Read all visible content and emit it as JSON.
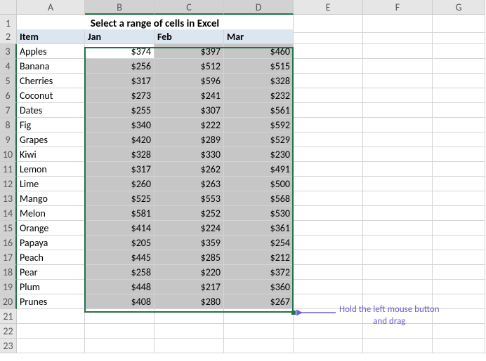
{
  "colLetters": [
    "A",
    "B",
    "C",
    "D",
    "E",
    "F",
    "G"
  ],
  "title": "Select a range of cells in Excel",
  "headers": [
    "Item",
    "Jan",
    "Feb",
    "Mar"
  ],
  "rows": [
    {
      "item": "Apples",
      "jan": "$374",
      "feb": "$397",
      "mar": "$460"
    },
    {
      "item": "Banana",
      "jan": "$256",
      "feb": "$512",
      "mar": "$515"
    },
    {
      "item": "Cherries",
      "jan": "$317",
      "feb": "$596",
      "mar": "$328"
    },
    {
      "item": "Coconut",
      "jan": "$273",
      "feb": "$241",
      "mar": "$232"
    },
    {
      "item": "Dates",
      "jan": "$255",
      "feb": "$307",
      "mar": "$561"
    },
    {
      "item": "Fig",
      "jan": "$340",
      "feb": "$222",
      "mar": "$592"
    },
    {
      "item": "Grapes",
      "jan": "$420",
      "feb": "$289",
      "mar": "$529"
    },
    {
      "item": "Kiwi",
      "jan": "$328",
      "feb": "$330",
      "mar": "$230"
    },
    {
      "item": "Lemon",
      "jan": "$317",
      "feb": "$262",
      "mar": "$491"
    },
    {
      "item": "Lime",
      "jan": "$260",
      "feb": "$263",
      "mar": "$500"
    },
    {
      "item": "Mango",
      "jan": "$525",
      "feb": "$553",
      "mar": "$568"
    },
    {
      "item": "Melon",
      "jan": "$581",
      "feb": "$252",
      "mar": "$530"
    },
    {
      "item": "Orange",
      "jan": "$414",
      "feb": "$224",
      "mar": "$361"
    },
    {
      "item": "Papaya",
      "jan": "$205",
      "feb": "$359",
      "mar": "$254"
    },
    {
      "item": "Peach",
      "jan": "$445",
      "feb": "$285",
      "mar": "$212"
    },
    {
      "item": "Pear",
      "jan": "$258",
      "feb": "$220",
      "mar": "$372"
    },
    {
      "item": "Plum",
      "jan": "$448",
      "feb": "$217",
      "mar": "$360"
    },
    {
      "item": "Prunes",
      "jan": "$408",
      "feb": "$280",
      "mar": "$267"
    }
  ],
  "annotation": "Hold the left mouse button\nand drag",
  "chart_data": {
    "type": "table",
    "title": "Select a range of cells in Excel",
    "columns": [
      "Item",
      "Jan",
      "Feb",
      "Mar"
    ],
    "series": [
      {
        "name": "Apples",
        "values": [
          374,
          397,
          460
        ]
      },
      {
        "name": "Banana",
        "values": [
          256,
          512,
          515
        ]
      },
      {
        "name": "Cherries",
        "values": [
          317,
          596,
          328
        ]
      },
      {
        "name": "Coconut",
        "values": [
          273,
          241,
          232
        ]
      },
      {
        "name": "Dates",
        "values": [
          255,
          307,
          561
        ]
      },
      {
        "name": "Fig",
        "values": [
          340,
          222,
          592
        ]
      },
      {
        "name": "Grapes",
        "values": [
          420,
          289,
          529
        ]
      },
      {
        "name": "Kiwi",
        "values": [
          328,
          330,
          230
        ]
      },
      {
        "name": "Lemon",
        "values": [
          317,
          262,
          491
        ]
      },
      {
        "name": "Lime",
        "values": [
          260,
          263,
          500
        ]
      },
      {
        "name": "Mango",
        "values": [
          525,
          553,
          568
        ]
      },
      {
        "name": "Melon",
        "values": [
          581,
          252,
          530
        ]
      },
      {
        "name": "Orange",
        "values": [
          414,
          224,
          361
        ]
      },
      {
        "name": "Papaya",
        "values": [
          205,
          359,
          254
        ]
      },
      {
        "name": "Peach",
        "values": [
          445,
          285,
          212
        ]
      },
      {
        "name": "Pear",
        "values": [
          258,
          220,
          372
        ]
      },
      {
        "name": "Plum",
        "values": [
          448,
          217,
          360
        ]
      },
      {
        "name": "Prunes",
        "values": [
          408,
          280,
          267
        ]
      }
    ]
  }
}
